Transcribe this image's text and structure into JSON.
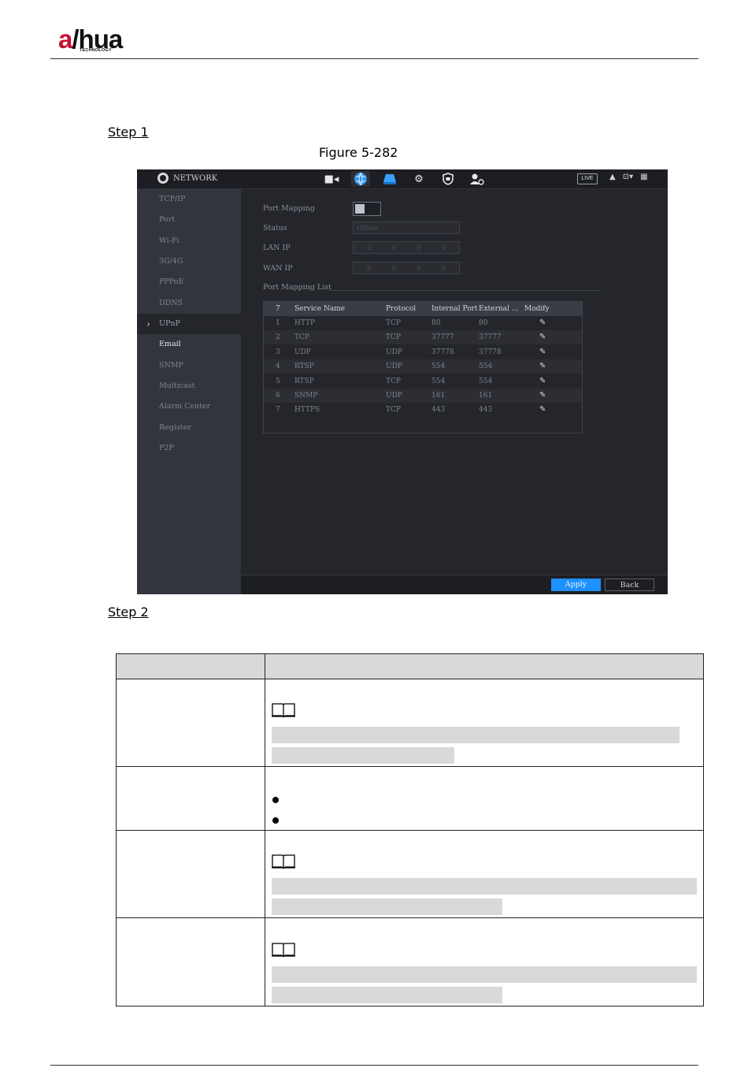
{
  "page": {
    "logo_main": "alhua",
    "logo_sub": "TECHNOLOGY",
    "step1": "Step 1",
    "figure_caption": "Figure 5-282",
    "step2": "Step 2"
  },
  "ui": {
    "topbar": {
      "title": "NETWORK",
      "live_label": "LIVE",
      "icons": [
        "camera-icon",
        "network-icon",
        "storage-icon",
        "system-icon",
        "security-icon",
        "account-icon"
      ]
    },
    "sidebar": {
      "items": [
        {
          "label": "TCP/IP"
        },
        {
          "label": "Port"
        },
        {
          "label": "Wi-Fi"
        },
        {
          "label": "3G/4G"
        },
        {
          "label": "PPPoE"
        },
        {
          "label": "DDNS"
        },
        {
          "label": "UPnP",
          "active": true
        },
        {
          "label": "Email"
        },
        {
          "label": "SNMP"
        },
        {
          "label": "Multicast"
        },
        {
          "label": "Alarm Center"
        },
        {
          "label": "Register"
        },
        {
          "label": "P2P"
        }
      ]
    },
    "form": {
      "port_mapping_label": "Port Mapping",
      "status_label": "Status",
      "status_value": "Offline",
      "lan_ip_label": "LAN IP",
      "lan_ip": [
        "0",
        "0",
        "0",
        "0"
      ],
      "wan_ip_label": "WAN IP",
      "wan_ip": [
        "0",
        "0",
        "0",
        "0"
      ],
      "list_title": "Port Mapping List"
    },
    "table": {
      "headers": [
        "7",
        "Service Name",
        "Protocol",
        "Internal Port",
        "External ...",
        "Modify"
      ],
      "rows": [
        [
          "1",
          "HTTP",
          "TCP",
          "80",
          "80"
        ],
        [
          "2",
          "TCP",
          "TCP",
          "37777",
          "37777"
        ],
        [
          "3",
          "UDP",
          "UDP",
          "37778",
          "37778"
        ],
        [
          "4",
          "RTSP",
          "UDP",
          "554",
          "554"
        ],
        [
          "5",
          "RTSP",
          "TCP",
          "554",
          "554"
        ],
        [
          "6",
          "SNMP",
          "UDP",
          "161",
          "161"
        ],
        [
          "7",
          "HTTPS",
          "TCP",
          "443",
          "443"
        ]
      ]
    },
    "buttons": {
      "apply": "Apply",
      "back": "Back"
    }
  }
}
